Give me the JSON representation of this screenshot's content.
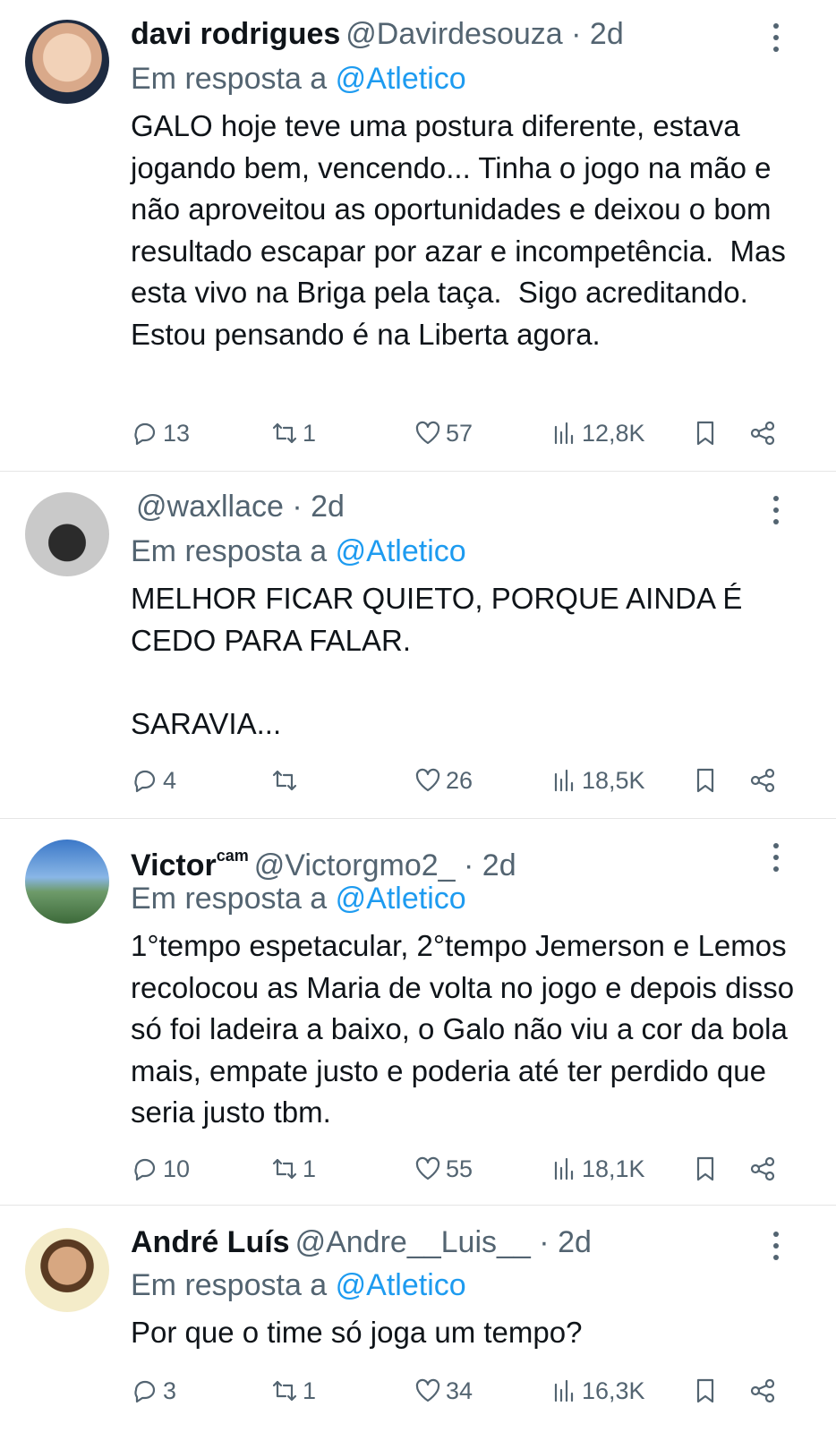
{
  "tweets": [
    {
      "avatar_icon": "profile-photo",
      "name": "davi rodrigues",
      "name_sup": "",
      "handle": "@Davirdesouza",
      "separator": "·",
      "time": "2d",
      "reply_prefix": "Em resposta a",
      "reply_to": "@Atletico",
      "text": "GALO hoje teve uma postura diferente, estava jogando bem, vencendo... Tinha o jogo na mão e não aproveitou as oportunidades e deixou o bom resultado escapar por azar e incompetência.  Mas esta vivo na Briga pela taça.  Sigo acreditando.  Estou pensando é na Liberta agora.",
      "replies": "13",
      "retweets": "1",
      "likes": "57",
      "views": "12,8K"
    },
    {
      "avatar_icon": "profile-photo",
      "name": "",
      "name_sup": "",
      "handle": "@waxllace",
      "separator": "·",
      "time": "2d",
      "reply_prefix": "Em resposta a",
      "reply_to": "@Atletico",
      "text": "MELHOR FICAR QUIETO, PORQUE AINDA É CEDO PARA FALAR.\n\nSARAVIA...",
      "replies": "4",
      "retweets": "",
      "likes": "26",
      "views": "18,5K"
    },
    {
      "avatar_icon": "profile-photo",
      "name": "Victor",
      "name_sup": "cam",
      "handle": "@Victorgmo2_",
      "separator": "·",
      "time": "2d",
      "reply_prefix": "Em resposta a",
      "reply_to": "@Atletico",
      "text": "1°tempo espetacular, 2°tempo Jemerson e Lemos recolocou as Maria de volta no jogo e depois disso só foi ladeira a baixo, o Galo não viu a cor da bola mais, empate justo e poderia até ter perdido que seria justo tbm.",
      "replies": "10",
      "retweets": "1",
      "likes": "55",
      "views": "18,1K"
    },
    {
      "avatar_icon": "profile-photo",
      "name": "André Luís",
      "name_sup": "",
      "handle": "@Andre__Luis__",
      "separator": "·",
      "time": "2d",
      "reply_prefix": "Em resposta a",
      "reply_to": "@Atletico",
      "text": "Por que o time só joga um tempo?",
      "replies": "3",
      "retweets": "1",
      "likes": "34",
      "views": "16,3K"
    }
  ],
  "icons": {
    "reply": "reply-icon",
    "retweet": "retweet-icon",
    "like": "heart-icon",
    "views": "views-icon",
    "bookmark": "bookmark-icon",
    "share": "share-icon",
    "more": "more-icon"
  },
  "colors": {
    "link": "#1d9bf0",
    "secondary": "#536471",
    "text": "#0f1419"
  }
}
